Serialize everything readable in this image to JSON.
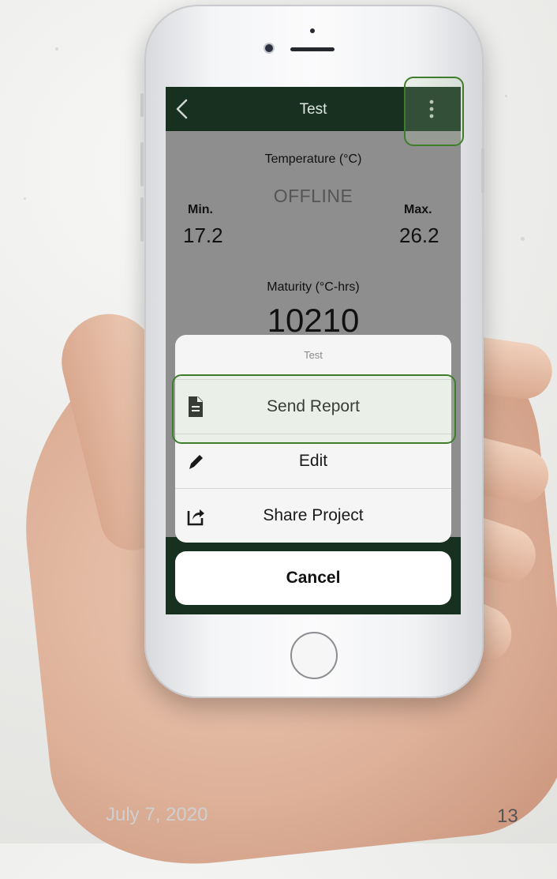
{
  "app": {
    "nav_title": "Test"
  },
  "temperature": {
    "title": "Temperature (°C)",
    "status": "OFFLINE",
    "min_label": "Min.",
    "min_value": "17.2",
    "max_label": "Max.",
    "max_value": "26.2"
  },
  "maturity": {
    "title": "Maturity (°C-hrs)",
    "value": "10210"
  },
  "action_sheet": {
    "title": "Test",
    "items": [
      {
        "label": "Send Report",
        "icon": "document-icon"
      },
      {
        "label": "Edit",
        "icon": "pencil-icon"
      },
      {
        "label": "Share Project",
        "icon": "share-icon"
      }
    ],
    "cancel_label": "Cancel"
  },
  "slide": {
    "date": "July 7, 2020",
    "page_number": "13"
  },
  "colors": {
    "nav_bar": "#17301f",
    "highlight": "#3f7d2c"
  }
}
